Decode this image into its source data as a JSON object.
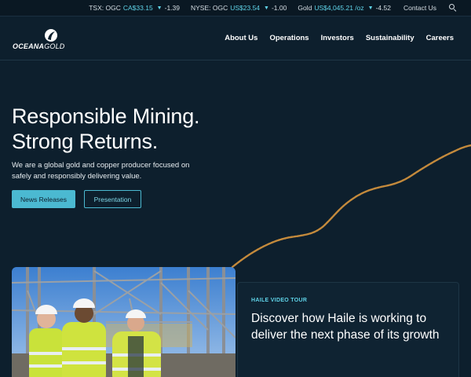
{
  "ticker": {
    "items": [
      {
        "label": "TSX: OGC",
        "currency": "CA",
        "value": "$33.15",
        "change": "-1.39"
      },
      {
        "label": "NYSE: OGC",
        "currency": "US",
        "value": "$23.54",
        "change": "-1.00"
      },
      {
        "label": "Gold",
        "currency": "US",
        "value": "$4,045.21 /oz",
        "change": "-4.52"
      }
    ],
    "contact_label": "Contact Us"
  },
  "brand": {
    "logo_part1": "OCEANA",
    "logo_part2": "GOLD",
    "accent_color": "#4bb9d1",
    "gold_color": "#c48a3c"
  },
  "nav": {
    "items": [
      "About Us",
      "Operations",
      "Investors",
      "Sustainability",
      "Careers"
    ]
  },
  "hero": {
    "title_line1": "Responsible Mining.",
    "title_line2": "Strong Returns.",
    "subtitle": "We are a global gold and copper producer focused on safely and responsibly delivering value.",
    "primary_button": "News Releases",
    "secondary_button": "Presentation"
  },
  "feature": {
    "tag": "HAILE VIDEO TOUR",
    "title": "Discover how Haile is working to deliver the next phase of its growth"
  }
}
